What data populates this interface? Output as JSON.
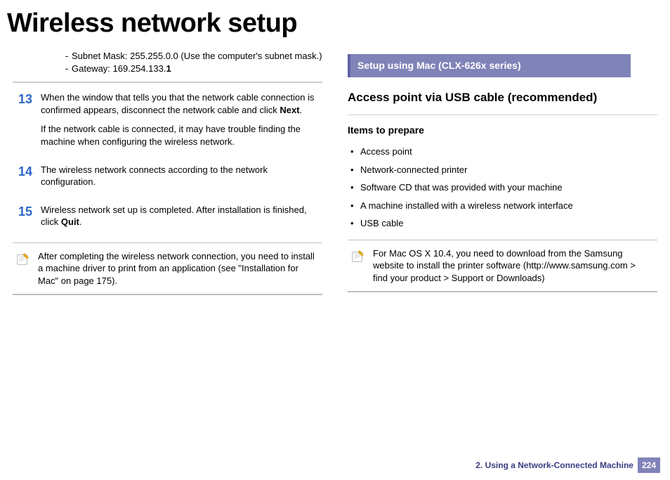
{
  "title": "Wireless network setup",
  "left": {
    "subnet_label": "Subnet Mask: 255.255.0.0 (Use the computer's subnet mask.)",
    "gateway_label_prefix": "Gateway: 169.254.133.",
    "gateway_label_bold": "1",
    "step13_num": "13",
    "step13_p1_a": "When the window that tells you that the network cable connection is confirmed appears, disconnect the network cable and click ",
    "step13_p1_b": "Next",
    "step13_p1_c": ".",
    "step13_p2": "If the network cable is connected, it may have trouble finding the machine when configuring the wireless network.",
    "step14_num": "14",
    "step14_p1": "The wireless network connects according to the network configuration.",
    "step15_num": "15",
    "step15_p1_a": "Wireless network set up is completed. After installation is finished, click ",
    "step15_p1_b": "Quit",
    "step15_p1_c": ".",
    "note1": "After completing the wireless network connection, you need to install a machine driver to print from an application (see \"Installation for Mac\" on page 175)."
  },
  "right": {
    "section_bar": "Setup using Mac (CLX-626x series)",
    "h2": "Access point via USB cable (recommended)",
    "h3": "Items to prepare",
    "items": [
      "Access point",
      "Network-connected printer",
      "Software CD that was provided with your machine",
      "A machine installed with a wireless network interface",
      " USB cable"
    ],
    "note2": "For Mac OS X 10.4, you need to download from the Samsung website to install the printer software (http://www.samsung.com > find your product > Support or Downloads)"
  },
  "footer": {
    "chapter": "2.  Using a Network-Connected Machine",
    "page": "224"
  }
}
